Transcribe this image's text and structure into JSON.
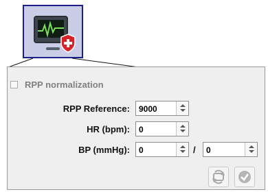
{
  "icon": {
    "name": "monitor-shield-icon"
  },
  "rpp_normalization": {
    "label": "RPP normalization",
    "checked": false,
    "enabled": false
  },
  "fields": {
    "rpp_reference": {
      "label": "RPP Reference:",
      "value": "9000"
    },
    "hr": {
      "label": "HR (bpm):",
      "value": "0"
    },
    "bp": {
      "label": "BP (mmHg):",
      "value_systolic": "0",
      "separator": "/",
      "value_diastolic": "0"
    }
  },
  "buttons": {
    "refresh": {
      "icon": "refresh-icon"
    },
    "confirm": {
      "icon": "checkmark-icon"
    }
  }
}
